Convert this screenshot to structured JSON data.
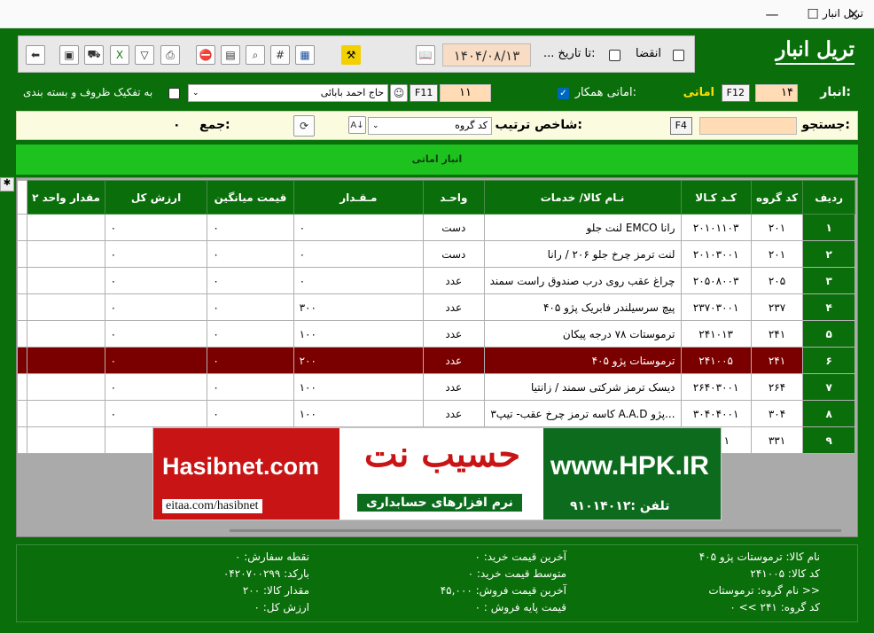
{
  "window": {
    "title": "تریل انبار",
    "minimize": "—",
    "maximize": "☐",
    "close": "✕"
  },
  "form_title": "تریل انبار",
  "toolbar": {
    "date_value": "۱۴۰۴/۰۸/۱۳",
    "to_date_label": "... تا تاریخ:",
    "expiry_label": "انقضا"
  },
  "warehouse_row": {
    "warehouse_label": "انبار:",
    "warehouse_code": "۱۴",
    "f12": "F12",
    "warehouse_name": "اماتی",
    "partner_label": "اماتی همکار:",
    "partner_code": "۱۱",
    "f11": "F11",
    "partner_name": "حاج احمد بابائی",
    "split_label": "به تفکیک ظروف و بسته بندی"
  },
  "search_row": {
    "search_label": "جستجو:",
    "f4": "F4",
    "sort_label": "شاخص ترتیب:",
    "sort_value": "کد گروه",
    "sum_label": "جمع:",
    "sum_value": "۰"
  },
  "band": {
    "text": "انبار اماتی"
  },
  "grid": {
    "columns": [
      "ردیف",
      "کد گروه",
      "کـد کـالا",
      "نـام کالا/ خدمات",
      "واحـد",
      "مـقـدار",
      "قیمت میانگین",
      "ارزش کل",
      "مقدار واحد ۲"
    ],
    "rows": [
      {
        "n": "۱",
        "g": "۲۰۱",
        "c": "۲۰۱۰۱۱۰۳",
        "name": "لنت جلو EMCO رانا",
        "u": "دست",
        "q": "۰",
        "p": "۰",
        "v": "۰",
        "q2": ""
      },
      {
        "n": "۲",
        "g": "۲۰۱",
        "c": "۲۰۱۰۳۰۰۱",
        "name": "لنت ترمز چرخ جلو ۲۰۶ / رانا",
        "u": "دست",
        "q": "۰",
        "p": "۰",
        "v": "۰",
        "q2": ""
      },
      {
        "n": "۳",
        "g": "۲۰۵",
        "c": "۲۰۵۰۸۰۰۳",
        "name": "چراغ عقب روی درب صندوق راست سمند",
        "u": "عدد",
        "q": "۰",
        "p": "۰",
        "v": "۰",
        "q2": ""
      },
      {
        "n": "۴",
        "g": "۲۳۷",
        "c": "۲۳۷۰۳۰۰۱",
        "name": "پیچ سرسیلندر فابریک پژو ۴۰۵",
        "u": "عدد",
        "q": "۳۰۰",
        "p": "۰",
        "v": "۰",
        "q2": ""
      },
      {
        "n": "۵",
        "g": "۲۴۱",
        "c": "۲۴۱۰۱۳",
        "name": "ترموستات ۷۸ درجه پیکان",
        "u": "عدد",
        "q": "۱۰۰",
        "p": "۰",
        "v": "۰",
        "q2": ""
      },
      {
        "n": "۶",
        "g": "۲۴۱",
        "c": "۲۴۱۰۰۵",
        "name": "ترموستات پژو ۴۰۵",
        "u": "عدد",
        "q": "۲۰۰",
        "p": "۰",
        "v": "۰",
        "q2": ""
      },
      {
        "n": "۷",
        "g": "۲۶۴",
        "c": "۲۶۴۰۳۰۰۱",
        "name": "دیسک ترمز شرکتی سمند / زانتیا",
        "u": "عدد",
        "q": "۱۰۰",
        "p": "۰",
        "v": "۰",
        "q2": ""
      },
      {
        "n": "۸",
        "g": "۳۰۴",
        "c": "۳۰۴۰۴۰۰۱",
        "name": "کاسه ترمز چرخ عقب- تیپ۳ A.A.D پژو...",
        "u": "عدد",
        "q": "۱۰۰",
        "p": "۰",
        "v": "۰",
        "q2": ""
      },
      {
        "n": "۹",
        "g": "۳۳۱",
        "c": "...۰۰۱",
        "name": "",
        "u": "",
        "q": "",
        "p": "",
        "v": "",
        "q2": ""
      }
    ]
  },
  "banner": {
    "left_title": "Hasibnet.com",
    "left_sub": "eitaa.com/hasibnet",
    "mid_title": "حسیب نت",
    "mid_sub": "نرم افزارهای حسابداری",
    "right_title": "www.HPK.IR",
    "right_phone": "تلفن :۹۱۰۱۴۰۱۲"
  },
  "footer": {
    "col_right": [
      {
        "label": "نام کالا:",
        "value": "ترموستات پژو ۴۰۵"
      },
      {
        "label": "کد کالا:",
        "value": "۲۴۱۰۰۵"
      },
      {
        "label": "نام گروه:",
        "value": "ترموستات >>"
      },
      {
        "label": "کد گروه:",
        "value": "۲۴۱ >> ۰"
      }
    ],
    "col_mid": [
      {
        "label": "آخرین قیمت خرید:",
        "value": "۰"
      },
      {
        "label": "متوسط قیمت خرید:",
        "value": "۰"
      },
      {
        "label": "آخرین قیمت فروش:",
        "value": "۴۵,۰۰۰"
      },
      {
        "label": "قیمت پایه فروش :",
        "value": "۰"
      }
    ],
    "col_left": [
      {
        "label": "نقطه سفارش:",
        "value": "۰"
      },
      {
        "label": "بارکد:",
        "value": "۰۴۲۰۷۰۰۲۹۹"
      },
      {
        "label": "مقدار کالا:",
        "value": "۲۰۰"
      },
      {
        "label": "ارزش کل:",
        "value": "۰"
      }
    ]
  },
  "colors": {
    "frame_green": "#0a6e0a",
    "band_green": "#1ec21e",
    "selected_row": "#7a0000",
    "peach_input": "#ffdcb5"
  }
}
